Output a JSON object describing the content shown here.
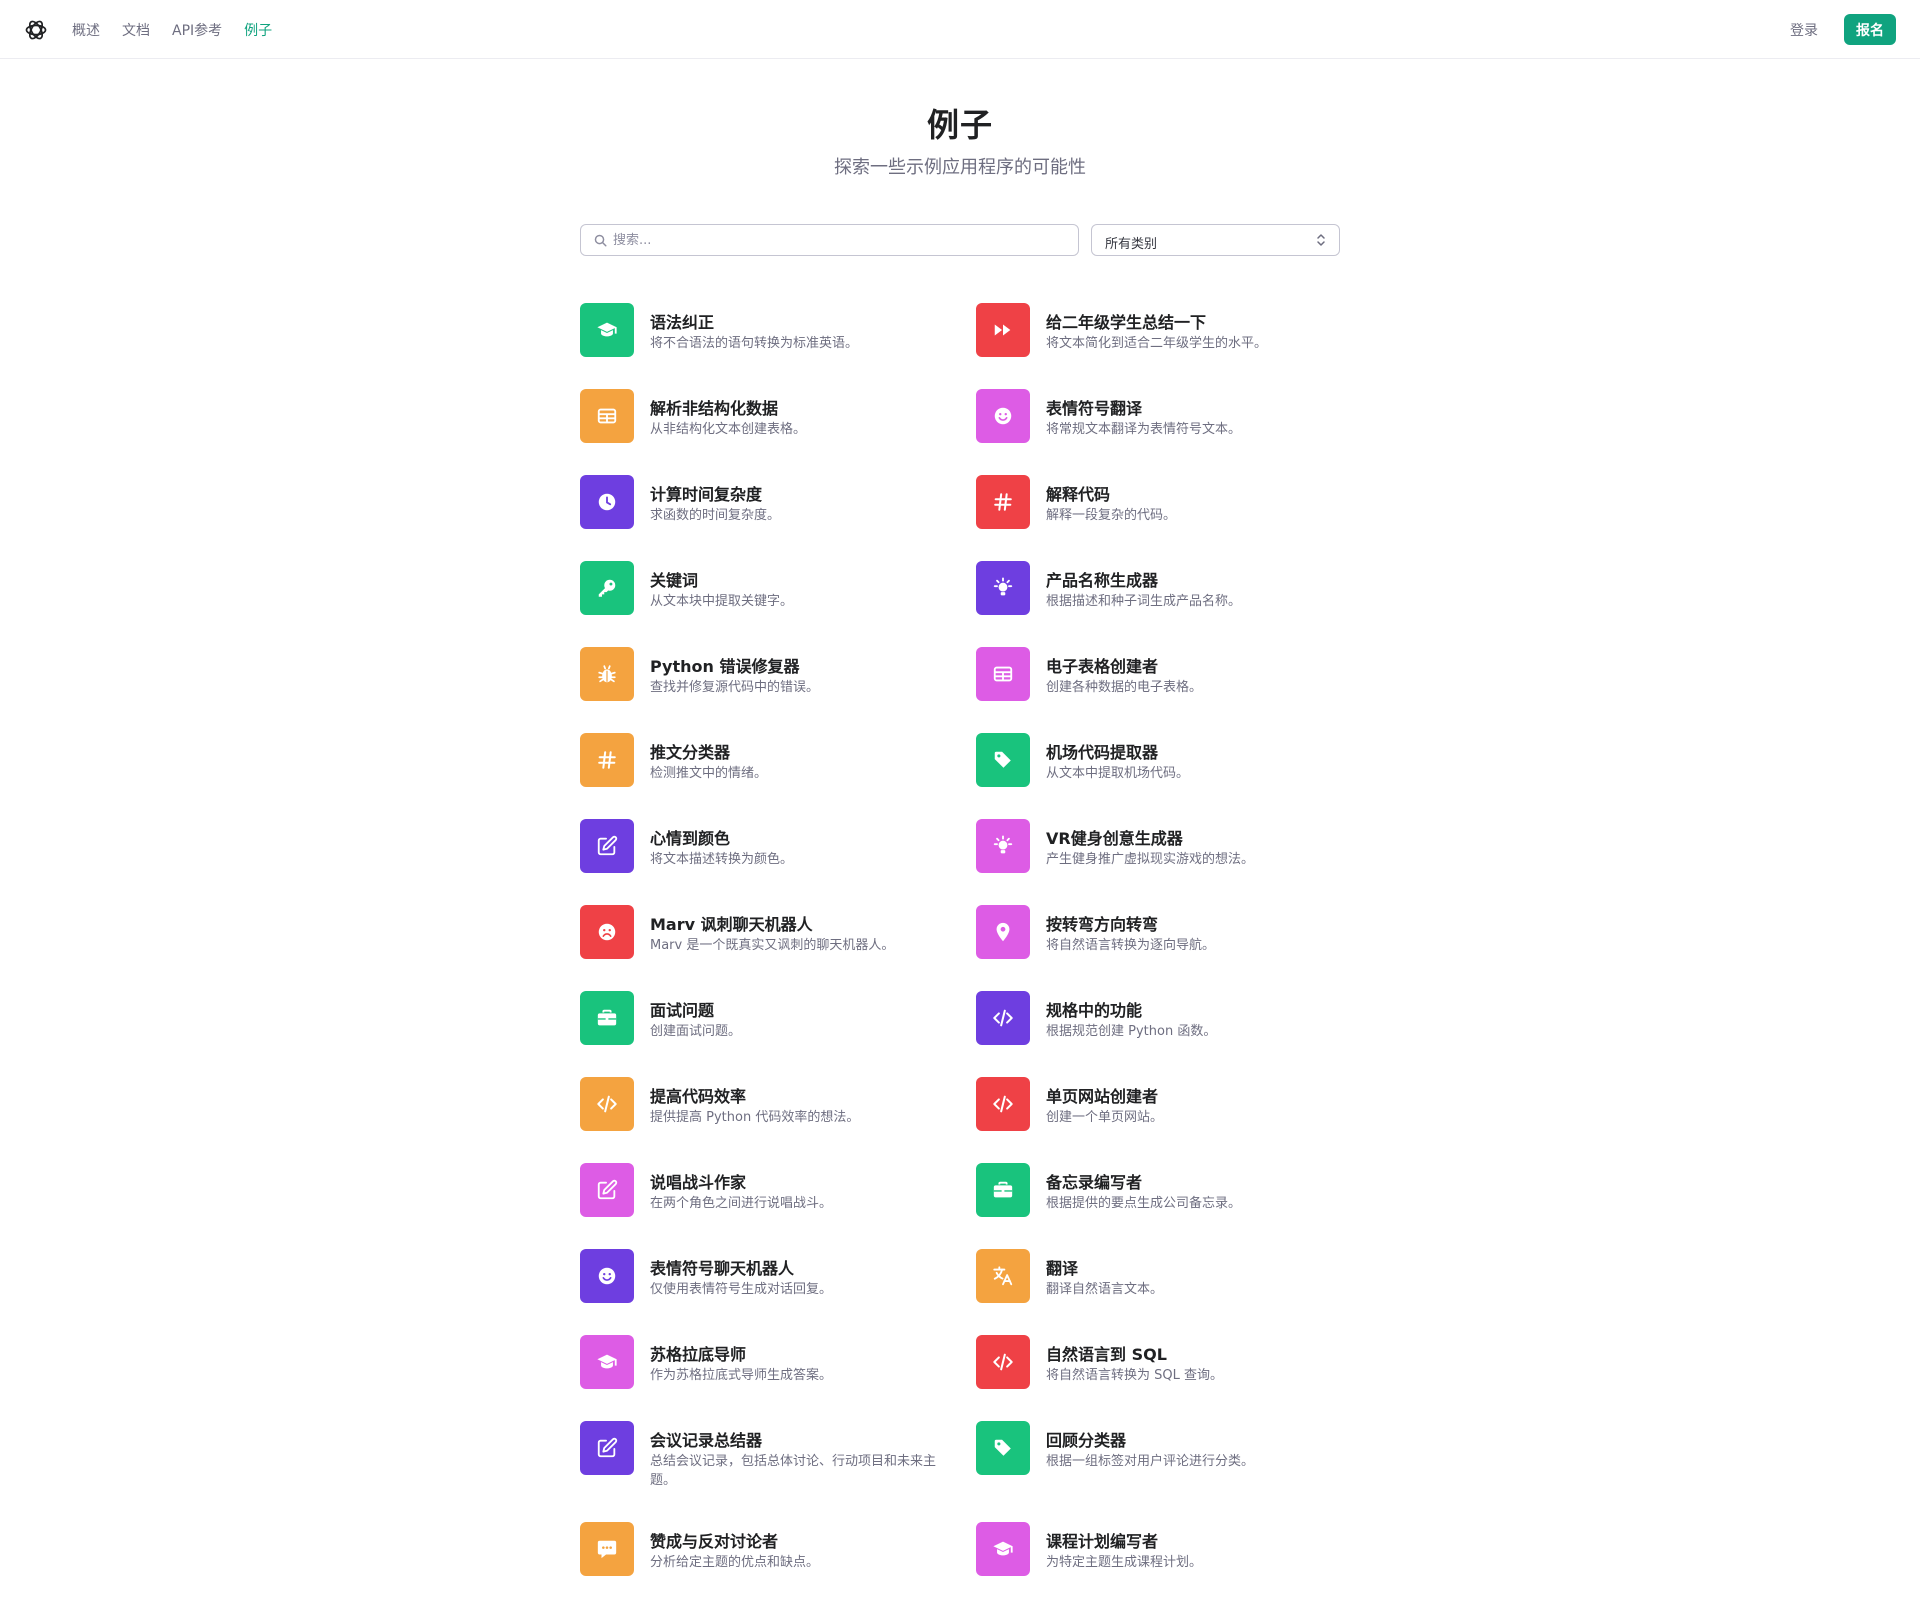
{
  "nav": {
    "links": [
      {
        "label": "概述"
      },
      {
        "label": "文档"
      },
      {
        "label": "API参考"
      },
      {
        "label": "例子",
        "active": true
      }
    ],
    "login_label": "登录",
    "signup_label": "报名"
  },
  "header": {
    "title": "例子",
    "subtitle": "探索一些示例应用程序的可能性"
  },
  "filters": {
    "search_placeholder": "搜索...",
    "category_value": "所有类别"
  },
  "colors": {
    "green": "#19c37d",
    "orange": "#f4a340",
    "purple": "#6e3ee0",
    "red": "#ef4146",
    "pink": "#dd5ce5",
    "brand": "#10a37f"
  },
  "examples": [
    {
      "title": "语法纠正",
      "desc": "将不合语法的语句转换为标准英语。",
      "icon": "graduation-cap-icon",
      "color": "green"
    },
    {
      "title": "给二年级学生总结一下",
      "desc": "将文本简化到适合二年级学生的水平。",
      "icon": "fast-forward-icon",
      "color": "red"
    },
    {
      "title": "解析非结构化数据",
      "desc": "从非结构化文本创建表格。",
      "icon": "table-icon",
      "color": "orange"
    },
    {
      "title": "表情符号翻译",
      "desc": "将常规文本翻译为表情符号文本。",
      "icon": "smile-icon",
      "color": "pink"
    },
    {
      "title": "计算时间复杂度",
      "desc": "求函数的时间复杂度。",
      "icon": "clock-icon",
      "color": "purple"
    },
    {
      "title": "解释代码",
      "desc": "解释一段复杂的代码。",
      "icon": "hashtag-icon",
      "color": "red"
    },
    {
      "title": "关键词",
      "desc": "从文本块中提取关键字。",
      "icon": "key-icon",
      "color": "green"
    },
    {
      "title": "产品名称生成器",
      "desc": "根据描述和种子词生成产品名称。",
      "icon": "lightbulb-icon",
      "color": "purple"
    },
    {
      "title": "Python 错误修复器",
      "desc": "查找并修复源代码中的错误。",
      "icon": "bug-icon",
      "color": "orange"
    },
    {
      "title": "电子表格创建者",
      "desc": "创建各种数据的电子表格。",
      "icon": "table-icon",
      "color": "pink"
    },
    {
      "title": "推文分类器",
      "desc": "检测推文中的情绪。",
      "icon": "hashtag-icon",
      "color": "orange"
    },
    {
      "title": "机场代码提取器",
      "desc": "从文本中提取机场代码。",
      "icon": "tag-icon",
      "color": "green"
    },
    {
      "title": "心情到颜色",
      "desc": "将文本描述转换为颜色。",
      "icon": "edit-icon",
      "color": "purple"
    },
    {
      "title": "VR健身创意生成器",
      "desc": "产生健身推广虚拟现实游戏的想法。",
      "icon": "lightbulb-icon",
      "color": "pink"
    },
    {
      "title": "Marv 讽刺聊天机器人",
      "desc": "Marv 是一个既真实又讽刺的聊天机器人。",
      "icon": "frown-icon",
      "color": "red"
    },
    {
      "title": "按转弯方向转弯",
      "desc": "将自然语言转换为逐向导航。",
      "icon": "map-pin-icon",
      "color": "pink"
    },
    {
      "title": "面试问题",
      "desc": "创建面试问题。",
      "icon": "briefcase-icon",
      "color": "green"
    },
    {
      "title": "规格中的功能",
      "desc": "根据规范创建 Python 函数。",
      "icon": "code-icon",
      "color": "purple"
    },
    {
      "title": "提高代码效率",
      "desc": "提供提高 Python 代码效率的想法。",
      "icon": "code-icon",
      "color": "orange"
    },
    {
      "title": "单页网站创建者",
      "desc": "创建一个单页网站。",
      "icon": "code-icon",
      "color": "red"
    },
    {
      "title": "说唱战斗作家",
      "desc": "在两个角色之间进行说唱战斗。",
      "icon": "edit-icon",
      "color": "pink"
    },
    {
      "title": "备忘录编写者",
      "desc": "根据提供的要点生成公司备忘录。",
      "icon": "briefcase-icon",
      "color": "green"
    },
    {
      "title": "表情符号聊天机器人",
      "desc": "仅使用表情符号生成对话回复。",
      "icon": "smile-icon",
      "color": "purple"
    },
    {
      "title": "翻译",
      "desc": "翻译自然语言文本。",
      "icon": "translate-icon",
      "color": "orange"
    },
    {
      "title": "苏格拉底导师",
      "desc": "作为苏格拉底式导师生成答案。",
      "icon": "graduation-cap-icon",
      "color": "pink"
    },
    {
      "title": "自然语言到 SQL",
      "desc": "将自然语言转换为 SQL 查询。",
      "icon": "code-icon",
      "color": "red"
    },
    {
      "title": "会议记录总结器",
      "desc": "总结会议记录，包括总体讨论、行动项目和未来主题。",
      "icon": "edit-icon",
      "color": "purple"
    },
    {
      "title": "回顾分类器",
      "desc": "根据一组标签对用户评论进行分类。",
      "icon": "tag-icon",
      "color": "green"
    },
    {
      "title": "赞成与反对讨论者",
      "desc": "分析给定主题的优点和缺点。",
      "icon": "chat-icon",
      "color": "orange"
    },
    {
      "title": "课程计划编写者",
      "desc": "为特定主题生成课程计划。",
      "icon": "graduation-cap-icon",
      "color": "pink"
    }
  ]
}
